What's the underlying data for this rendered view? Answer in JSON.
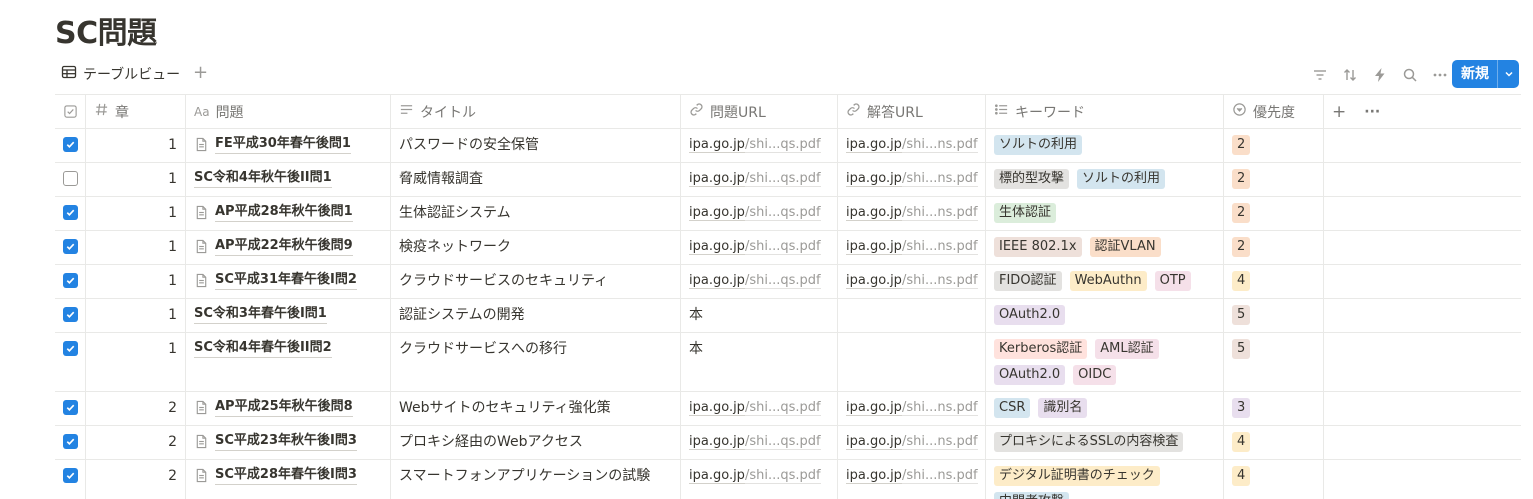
{
  "page": {
    "title": "SC問題"
  },
  "toolbar": {
    "view_label": "テーブルビュー",
    "add_view": "+",
    "new_label": "新規"
  },
  "headers": {
    "chapter": "章",
    "question": "問題",
    "title": "タイトル",
    "question_url": "問題URL",
    "answer_url": "解答URL",
    "keywords": "キーワード",
    "priority": "優先度",
    "add": "+",
    "more": "···"
  },
  "colors": {
    "accent": "#2383e2",
    "tag_blue": "#d3e5ef",
    "tag_gray": "#e3e2e0",
    "tag_green": "#dbeddb",
    "tag_orange": "#fadec9",
    "tag_yellow": "#fdecc8",
    "tag_pink": "#f5e0e9",
    "tag_purple": "#e8deee",
    "tag_red": "#ffe2dd",
    "tag_brown": "#eee0da"
  },
  "rows": [
    {
      "checked": true,
      "chapter": "1",
      "question": "FE平成30年春午後問1",
      "has_doc_icon": true,
      "title": "パスワードの安全保管",
      "qurl_host": "ipa.go.jp",
      "qurl_path": "/shi...qs.pdf",
      "aurl_host": "ipa.go.jp",
      "aurl_path": "/shi...ns.pdf",
      "keywords": [
        {
          "label": "ソルトの利用",
          "color": "tag_blue"
        }
      ],
      "priority": {
        "label": "2",
        "color": "tag_orange"
      }
    },
    {
      "checked": false,
      "chapter": "1",
      "question": "SC令和4年秋午後II問1",
      "has_doc_icon": false,
      "title": "脅威情報調査",
      "qurl_host": "ipa.go.jp",
      "qurl_path": "/shi...qs.pdf",
      "aurl_host": "ipa.go.jp",
      "aurl_path": "/shi...ns.pdf",
      "keywords": [
        {
          "label": "標的型攻撃",
          "color": "tag_gray"
        },
        {
          "label": "ソルトの利用",
          "color": "tag_blue"
        }
      ],
      "priority": {
        "label": "2",
        "color": "tag_orange"
      }
    },
    {
      "checked": true,
      "chapter": "1",
      "question": "AP平成28年秋午後問1",
      "has_doc_icon": true,
      "title": "生体認証システム",
      "qurl_host": "ipa.go.jp",
      "qurl_path": "/shi...qs.pdf",
      "aurl_host": "ipa.go.jp",
      "aurl_path": "/shi...ns.pdf",
      "keywords": [
        {
          "label": "生体認証",
          "color": "tag_green"
        }
      ],
      "priority": {
        "label": "2",
        "color": "tag_orange"
      }
    },
    {
      "checked": true,
      "chapter": "1",
      "question": "AP平成22年秋午後問9",
      "has_doc_icon": true,
      "title": "検疫ネットワーク",
      "qurl_host": "ipa.go.jp",
      "qurl_path": "/shi...qs.pdf",
      "aurl_host": "ipa.go.jp",
      "aurl_path": "/shi...ns.pdf",
      "keywords": [
        {
          "label": "IEEE 802.1x",
          "color": "tag_brown"
        },
        {
          "label": "認証VLAN",
          "color": "tag_orange"
        }
      ],
      "priority": {
        "label": "2",
        "color": "tag_orange"
      }
    },
    {
      "checked": true,
      "chapter": "1",
      "question": "SC平成31年春午後I問2",
      "has_doc_icon": true,
      "title": "クラウドサービスのセキュリティ",
      "qurl_host": "ipa.go.jp",
      "qurl_path": "/shi...qs.pdf",
      "aurl_host": "ipa.go.jp",
      "aurl_path": "/shi...ns.pdf",
      "keywords": [
        {
          "label": "FIDO認証",
          "color": "tag_gray"
        },
        {
          "label": "WebAuthn",
          "color": "tag_yellow"
        },
        {
          "label": "OTP",
          "color": "tag_pink"
        }
      ],
      "priority": {
        "label": "4",
        "color": "tag_yellow"
      }
    },
    {
      "checked": true,
      "chapter": "1",
      "question": "SC令和3年春午後I問1",
      "has_doc_icon": false,
      "title": "認証システムの開発",
      "qurl_text": "本",
      "aurl_text": "",
      "keywords": [
        {
          "label": "OAuth2.0",
          "color": "tag_purple"
        }
      ],
      "priority": {
        "label": "5",
        "color": "tag_brown"
      }
    },
    {
      "checked": true,
      "chapter": "1",
      "question": "SC令和4年春午後II問2",
      "has_doc_icon": false,
      "title": "クラウドサービスへの移行",
      "qurl_text": "本",
      "aurl_text": "",
      "keywords": [
        {
          "label": "Kerberos認証",
          "color": "tag_red"
        },
        {
          "label": "AML認証",
          "color": "tag_pink"
        },
        {
          "label": "OAuth2.0",
          "color": "tag_purple"
        },
        {
          "label": "OIDC",
          "color": "tag_pink"
        }
      ],
      "priority": {
        "label": "5",
        "color": "tag_brown"
      }
    },
    {
      "checked": true,
      "chapter": "2",
      "question": "AP平成25年秋午後問8",
      "has_doc_icon": true,
      "title": "Webサイトのセキュリティ強化策",
      "qurl_host": "ipa.go.jp",
      "qurl_path": "/shi...qs.pdf",
      "aurl_host": "ipa.go.jp",
      "aurl_path": "/shi...ns.pdf",
      "keywords": [
        {
          "label": "CSR",
          "color": "tag_blue"
        },
        {
          "label": "識別名",
          "color": "tag_purple"
        }
      ],
      "priority": {
        "label": "3",
        "color": "tag_purple"
      }
    },
    {
      "checked": true,
      "chapter": "2",
      "question": "SC平成23年秋午後I問3",
      "has_doc_icon": true,
      "title": "プロキシ経由のWebアクセス",
      "qurl_host": "ipa.go.jp",
      "qurl_path": "/shi...qs.pdf",
      "aurl_host": "ipa.go.jp",
      "aurl_path": "/shi...ns.pdf",
      "keywords": [
        {
          "label": "プロキシによるSSLの内容検査",
          "color": "tag_gray"
        }
      ],
      "priority": {
        "label": "4",
        "color": "tag_yellow"
      }
    },
    {
      "checked": true,
      "chapter": "2",
      "question": "SC平成28年春午後I問3",
      "has_doc_icon": true,
      "title": "スマートフォンアプリケーションの試験",
      "qurl_host": "ipa.go.jp",
      "qurl_path": "/shi...qs.pdf",
      "aurl_host": "ipa.go.jp",
      "aurl_path": "/shi...ns.pdf",
      "keywords": [
        {
          "label": "デジタル証明書のチェック",
          "color": "tag_yellow"
        },
        {
          "label": "中間者攻撃",
          "color": "tag_blue"
        }
      ],
      "priority": {
        "label": "4",
        "color": "tag_yellow"
      }
    }
  ]
}
